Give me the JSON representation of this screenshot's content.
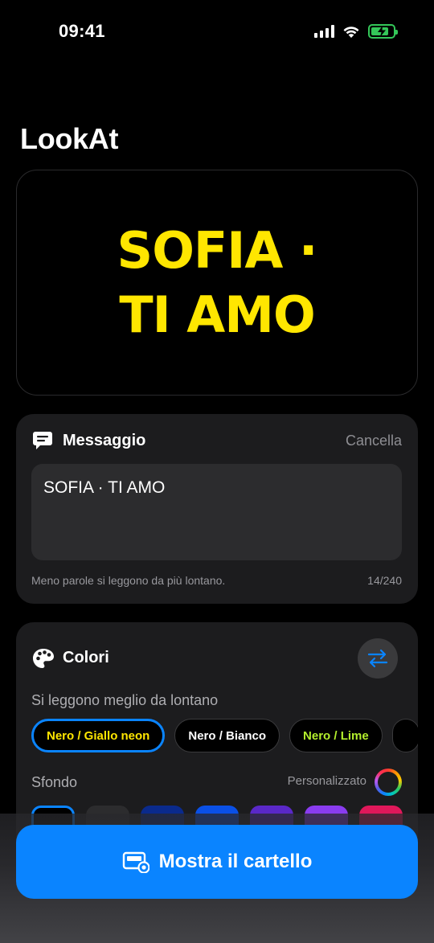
{
  "status_bar": {
    "time": "09:41",
    "battery_level": 0.8,
    "battery_charging": true
  },
  "app": {
    "title": "LookAt"
  },
  "preview": {
    "text": "SOFIA · TI AMO",
    "text_color": "#FFE600",
    "background_color": "#000000"
  },
  "message_card": {
    "title": "Messaggio",
    "icon": "message-bubble-icon",
    "clear_label": "Cancella",
    "input_value": "SOFIA · TI AMO",
    "hint": "Meno parole si leggono da più lontano.",
    "counter": "14/240"
  },
  "colors_card": {
    "title": "Colori",
    "icon": "palette-icon",
    "swap_icon": "swap-arrows-icon",
    "presets_label": "Si leggono meglio da lontano",
    "presets": [
      {
        "label": "Nero / Giallo neon",
        "text_color": "#FFE600",
        "bg_color": "#000000",
        "selected": true
      },
      {
        "label": "Nero / Bianco",
        "text_color": "#FFFFFF",
        "bg_color": "#000000",
        "selected": false
      },
      {
        "label": "Nero / Lime",
        "text_color": "#B4F02D",
        "bg_color": "#000000",
        "selected": false
      },
      {
        "label": "",
        "text_color": "#5AC8FA",
        "bg_color": "#000000",
        "selected": false
      }
    ],
    "background_label": "Sfondo",
    "custom_label": "Personalizzato",
    "background_swatches": [
      {
        "color": "#000000",
        "selected": true
      },
      {
        "color": "#2c2c2e",
        "selected": false
      },
      {
        "color": "#0a2a8c",
        "selected": false
      },
      {
        "color": "#0a50e6",
        "selected": false
      },
      {
        "color": "#5a28c8",
        "selected": false
      },
      {
        "color": "#8a3cf0",
        "selected": false
      },
      {
        "color": "#e0185a",
        "selected": false
      }
    ]
  },
  "primary_action": {
    "label": "Mostra il cartello",
    "icon": "display-sign-icon"
  },
  "colors": {
    "accent": "#0A84FF",
    "card_bg": "#1C1C1E",
    "neon_yellow": "#FFE600"
  }
}
